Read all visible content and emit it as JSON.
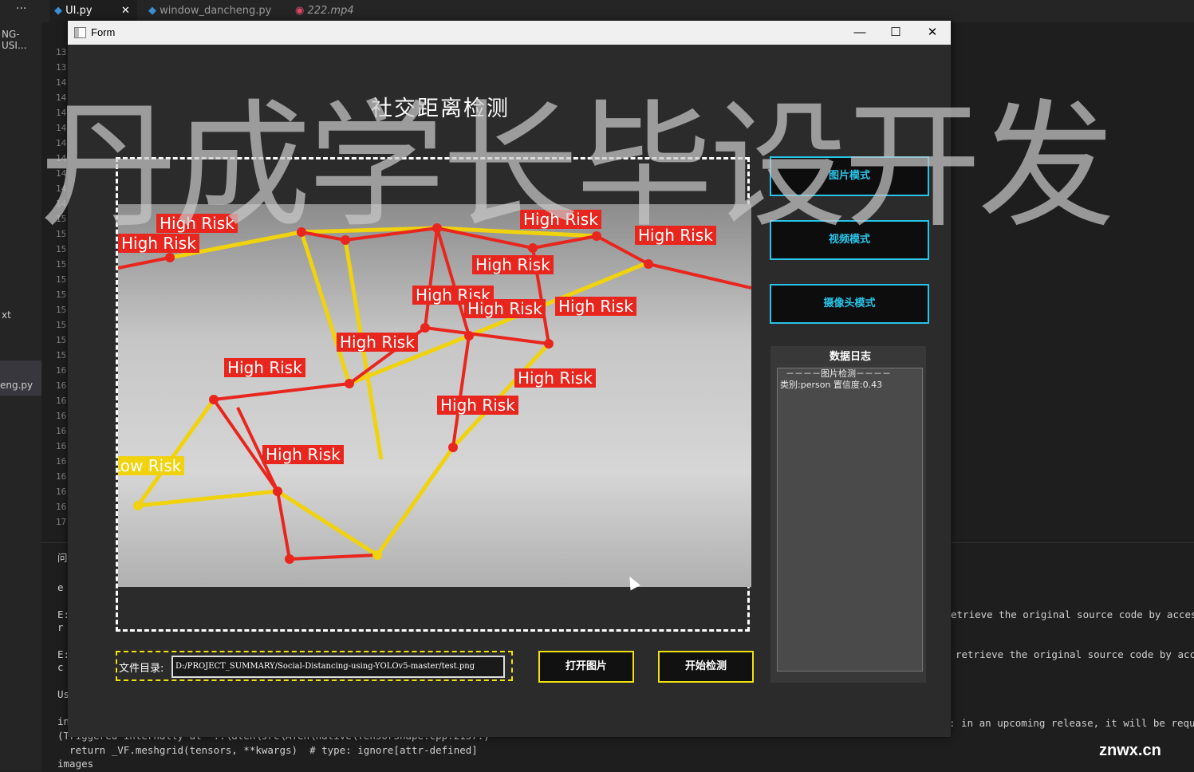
{
  "ide": {
    "tabs": [
      {
        "label": "UI.py",
        "active": true,
        "close": "✕"
      },
      {
        "label": "window_dancheng.py"
      },
      {
        "label": "222.mp4"
      }
    ],
    "sidebar": [
      "NG-USI...",
      "xt",
      "eng.py"
    ],
    "gutter": [
      "13",
      "13",
      "14",
      "14",
      "14",
      "14",
      "14",
      "14",
      "14",
      "14",
      "14",
      "15",
      "15",
      "15",
      "15",
      "15",
      "15",
      "15",
      "15",
      "15",
      "15",
      "16",
      "16",
      "16",
      "16",
      "16",
      "16",
      "16",
      "16",
      "16",
      "16",
      "17"
    ],
    "panel_left": [
      "问",
      "e",
      "E:",
      "r",
      "E:",
      "c",
      "Us",
      "in"
    ],
    "terminal_bottom": [
      "(Triggered internally at  ..\\aten\\src\\ATen\\native\\TensorShape.cpp:2157.)",
      "  return _VF.meshgrid(tensors, **kwargs)  # type: ignore[attr-defined]",
      "images"
    ],
    "terminal_right": [
      "etrieve the original source code by accessin",
      "retrieve the original source code by access",
      ": in an upcoming release, it will be require"
    ]
  },
  "form": {
    "window_title": "Form",
    "controls": {
      "minimize": "—",
      "maximize": "☐",
      "close": "✕"
    },
    "app_title": "社交距离检测",
    "mode_buttons": [
      "图片模式",
      "视频模式",
      "摄像头模式"
    ],
    "log": {
      "title": "数据日志",
      "lines": [
        "－－－－图片检测－－－－",
        "类别:person  置信度:0.43"
      ]
    },
    "path": {
      "label": "文件目录:",
      "value": "D:/PROJECT_SUMMARY/Social-Distancing-using-YOLOv5-master/test.png"
    },
    "open_button": "打开图片",
    "detect_button": "开始检测"
  },
  "detection": {
    "labels": [
      {
        "text": "High Risk",
        "color": "#e8261e"
      },
      {
        "text": "High Risk",
        "color": "#e8261e"
      },
      {
        "text": "High Risk",
        "color": "#e8261e"
      },
      {
        "text": "High Risk",
        "color": "#e8261e"
      },
      {
        "text": "High Risk",
        "color": "#e8261e"
      },
      {
        "text": "High Risk",
        "color": "#e8261e"
      },
      {
        "text": "High Risk",
        "color": "#e8261e"
      },
      {
        "text": "High Risk",
        "color": "#e8261e"
      },
      {
        "text": "High Risk",
        "color": "#e8261e"
      },
      {
        "text": "High Risk",
        "color": "#e8261e"
      },
      {
        "text": "High Risk",
        "color": "#e8261e"
      },
      {
        "text": "High Risk",
        "color": "#e8261e"
      },
      {
        "text": "High Risk",
        "color": "#e8261e"
      },
      {
        "text": "Low Risk",
        "color": "#f0d20f"
      }
    ]
  },
  "watermark": "丹成学长毕设开发",
  "site": "znwx.cn",
  "colors": {
    "accent": "#29c3e8",
    "yellow": "#f1e10e",
    "high_risk": "#e8261e",
    "low_risk": "#f0d20f"
  }
}
